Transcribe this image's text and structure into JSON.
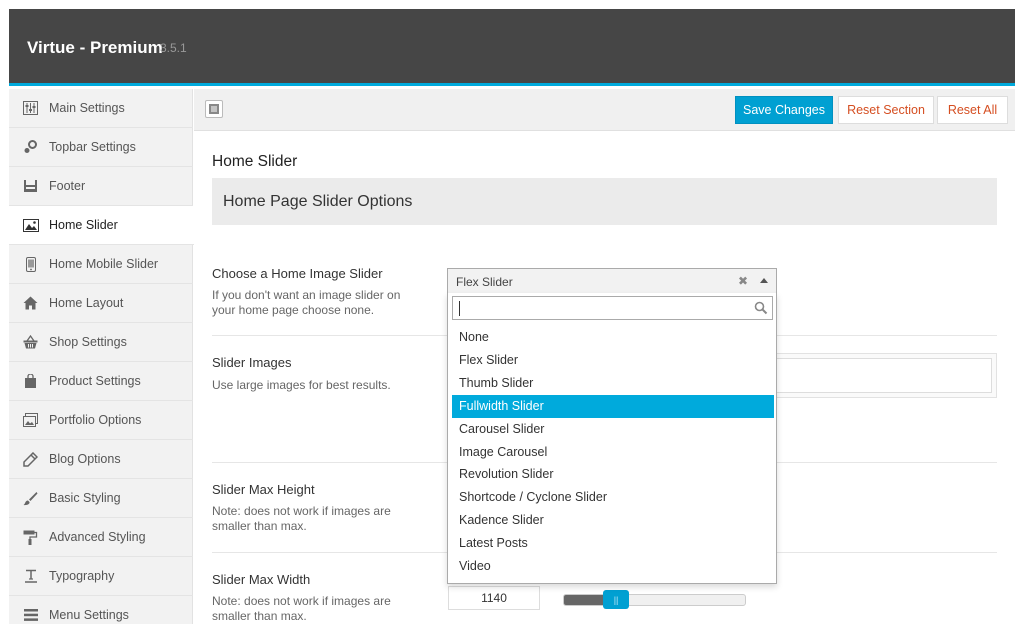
{
  "app": {
    "title": "Virtue - Premium",
    "version": "3.5.1"
  },
  "sidebar": {
    "items": [
      {
        "label": "Main Settings",
        "icon": "sliders-icon"
      },
      {
        "label": "Topbar Settings",
        "icon": "cog-icon"
      },
      {
        "label": "Footer",
        "icon": "footer-icon"
      },
      {
        "label": "Home Slider",
        "icon": "picture-icon",
        "active": true
      },
      {
        "label": "Home Mobile Slider",
        "icon": "mobile-icon"
      },
      {
        "label": "Home Layout",
        "icon": "home-icon"
      },
      {
        "label": "Shop Settings",
        "icon": "basket-icon"
      },
      {
        "label": "Product Settings",
        "icon": "bag-icon"
      },
      {
        "label": "Portfolio Options",
        "icon": "portfolio-icon"
      },
      {
        "label": "Blog Options",
        "icon": "pen-icon"
      },
      {
        "label": "Basic Styling",
        "icon": "brush-icon"
      },
      {
        "label": "Advanced Styling",
        "icon": "roller-icon"
      },
      {
        "label": "Typography",
        "icon": "text-icon"
      },
      {
        "label": "Menu Settings",
        "icon": "menu-icon"
      }
    ]
  },
  "toolbar": {
    "save_label": "Save Changes",
    "reset_section_label": "Reset Section",
    "reset_all_label": "Reset All"
  },
  "main": {
    "section_title": "Home Slider",
    "subsection_title": "Home Page Slider Options",
    "fields": {
      "slider_choice": {
        "label": "Choose a Home Image Slider",
        "desc": "If you don't want an image slider on your home page choose none.",
        "value": "Flex Slider"
      },
      "slider_images": {
        "label": "Slider Images",
        "desc": "Use large images for best results."
      },
      "max_height": {
        "label": "Slider Max Height",
        "desc": "Note: does not work if images are smaller than max."
      },
      "max_width": {
        "label": "Slider Max Width",
        "desc": "Note: does not work if images are smaller than max.",
        "value": "1140",
        "slider_fraction": 0.29
      }
    }
  },
  "dropdown": {
    "search_value": "",
    "options": [
      "None",
      "Flex Slider",
      "Thumb Slider",
      "Fullwidth Slider",
      "Carousel Slider",
      "Image Carousel",
      "Revolution Slider",
      "Shortcode / Cyclone Slider",
      "Kadence Slider",
      "Latest Posts",
      "Video"
    ],
    "highlighted": "Fullwidth Slider"
  },
  "colors": {
    "accent": "#00a0d2",
    "topbar": "#464646",
    "reset_text": "#d54e21"
  }
}
